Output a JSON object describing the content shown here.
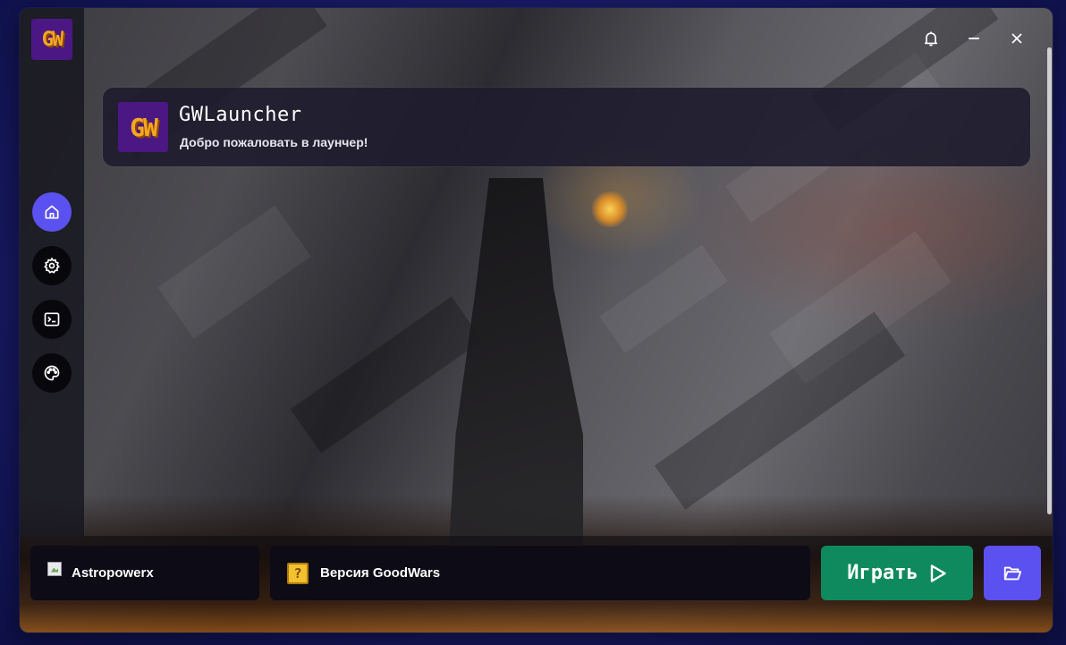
{
  "app": {
    "logo_text": "GW"
  },
  "titlebar": {
    "icons": [
      "bell-icon",
      "minimize-icon",
      "close-icon"
    ]
  },
  "sidebar": {
    "items": [
      {
        "icon": "home-icon",
        "active": true
      },
      {
        "icon": "gear-icon",
        "active": false
      },
      {
        "icon": "terminal-icon",
        "active": false
      },
      {
        "icon": "palette-icon",
        "active": false
      }
    ]
  },
  "header": {
    "logo_text": "GW",
    "title": "GWLauncher",
    "subtitle": "Добро пожаловать в лаунчер!"
  },
  "bottom": {
    "username": "Astropowerx",
    "version_label": "Версия GoodWars",
    "version_icon_glyph": "?",
    "play_label": "Играть",
    "folder_icon": "folder-open-icon"
  },
  "colors": {
    "accent": "#5b50f0",
    "play": "#0f8a5f",
    "panel": "#0c0b16",
    "logo_bg": "#4b1783",
    "logo_fg": "#f5a623"
  }
}
